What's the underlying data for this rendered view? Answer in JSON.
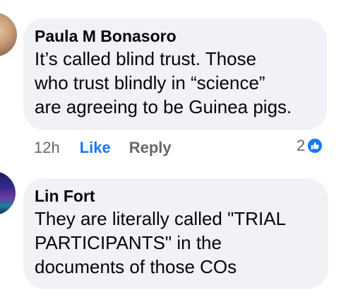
{
  "comments": [
    {
      "author": "Paula M Bonasoro",
      "text": "It’s called blind trust. Those\nwho trust blindly in “science”\nare agreeing to be Guinea pigs.",
      "time": "12h",
      "like_label": "Like",
      "reply_label": "Reply",
      "reaction_count": "2",
      "reaction_icon": "thumbs-up-icon",
      "reaction_color": "#1877f2"
    },
    {
      "author": "Lin Fort",
      "text": "They are literally called \"TRIAL\nPARTICIPANTS\" in the\ndocuments of those COs"
    }
  ],
  "colors": {
    "bubble_bg": "#f0f2f5",
    "link_blue": "#1877f2",
    "meta_gray": "#65676b",
    "text": "#050505"
  }
}
